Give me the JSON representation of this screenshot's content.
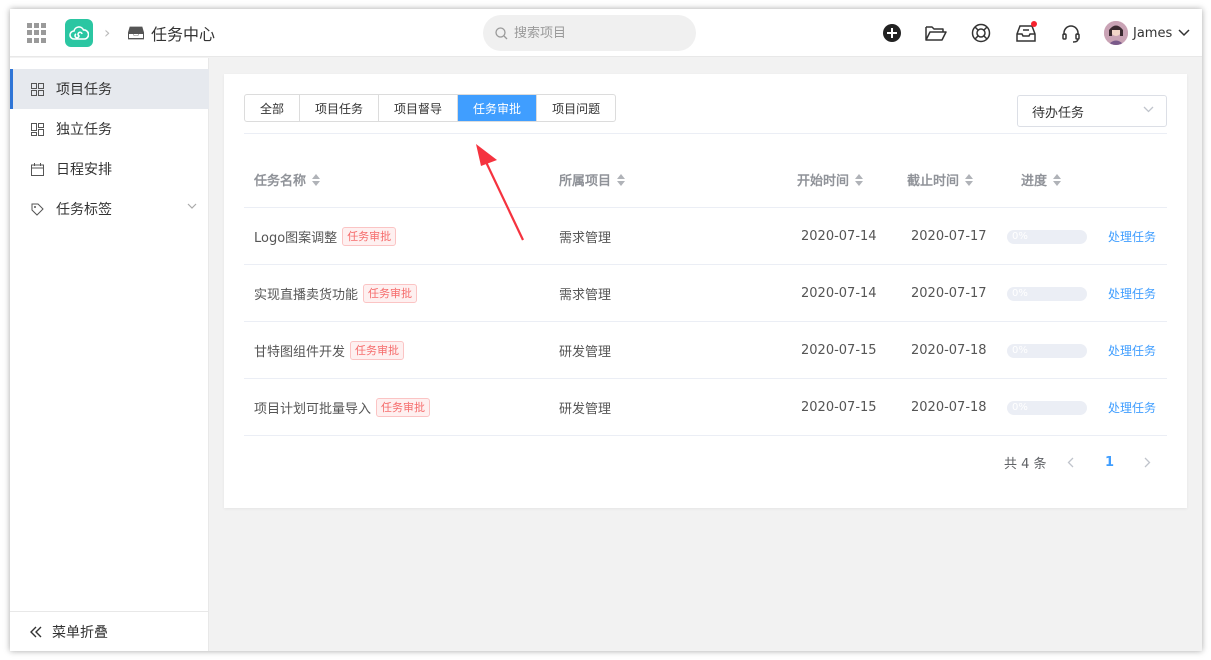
{
  "header": {
    "breadcrumb_title": "任务中心",
    "search_placeholder": "搜索项目",
    "user_name": "James",
    "colors": {
      "logo": "#2bc6a2",
      "notification_dot": "#f5222d"
    }
  },
  "sidebar": {
    "items": [
      {
        "label": "项目任务",
        "icon": "grid-icon",
        "active": true
      },
      {
        "label": "独立任务",
        "icon": "dashboard-icon",
        "active": false
      },
      {
        "label": "日程安排",
        "icon": "calendar-icon",
        "active": false
      },
      {
        "label": "任务标签",
        "icon": "tag-icon",
        "active": false
      }
    ],
    "collapse_label": "菜单折叠"
  },
  "tabs": [
    {
      "label": "全部",
      "active": false
    },
    {
      "label": "项目任务",
      "active": false
    },
    {
      "label": "项目督导",
      "active": false
    },
    {
      "label": "任务审批",
      "active": true
    },
    {
      "label": "项目问题",
      "active": false
    }
  ],
  "filter": {
    "selected": "待办任务"
  },
  "table": {
    "columns": [
      {
        "label": "任务名称"
      },
      {
        "label": "所属项目"
      },
      {
        "label": "开始时间"
      },
      {
        "label": "截止时间"
      },
      {
        "label": "进度"
      }
    ],
    "rows": [
      {
        "name": "Logo图案调整",
        "tag": "任务审批",
        "project": "需求管理",
        "start": "2020-07-14",
        "end": "2020-07-17",
        "progress": 0,
        "progress_label": "0%",
        "action": "处理任务"
      },
      {
        "name": "实现直播卖货功能",
        "tag": "任务审批",
        "project": "需求管理",
        "start": "2020-07-14",
        "end": "2020-07-17",
        "progress": 0,
        "progress_label": "0%",
        "action": "处理任务"
      },
      {
        "name": "甘特图组件开发",
        "tag": "任务审批",
        "project": "研发管理",
        "start": "2020-07-15",
        "end": "2020-07-18",
        "progress": 0,
        "progress_label": "0%",
        "action": "处理任务"
      },
      {
        "name": "项目计划可批量导入",
        "tag": "任务审批",
        "project": "研发管理",
        "start": "2020-07-15",
        "end": "2020-07-18",
        "progress": 0,
        "progress_label": "0%",
        "action": "处理任务"
      }
    ]
  },
  "pagination": {
    "total_label": "共 4 条",
    "current_page": "1"
  },
  "colors": {
    "primary": "#409eff",
    "tag_red": "#f56c6c",
    "arrow_red": "#f5333f"
  }
}
